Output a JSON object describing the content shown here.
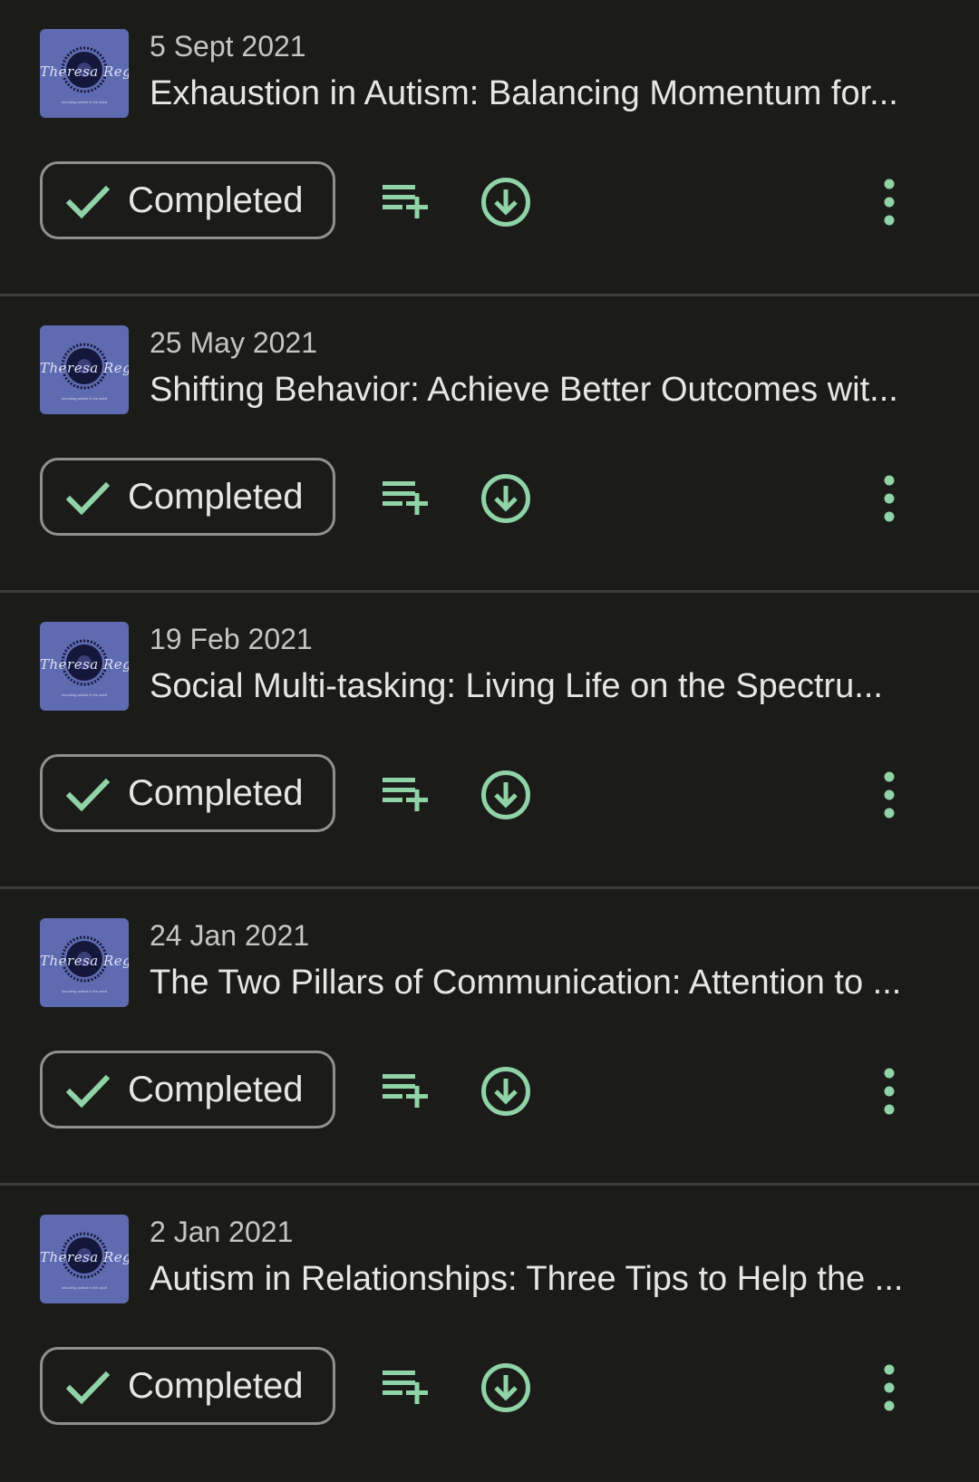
{
  "colors": {
    "background": "#1b1c1a",
    "accent": "#8fd3a6",
    "thumbnail": "#5f6bb0",
    "divider": "#3c3e3b"
  },
  "episodes": [
    {
      "date": "5 Sept 2021",
      "title": "Exhaustion in Autism: Balancing Momentum for...",
      "thumb_text": "Theresa Regan",
      "thumb_tagline": "decoding autism in the adult",
      "completed_label": "Completed",
      "icons": [
        "check-icon",
        "add-to-queue-icon",
        "download-icon",
        "more-vert-icon"
      ]
    },
    {
      "date": "25 May 2021",
      "title": "Shifting Behavior: Achieve Better Outcomes wit...",
      "thumb_text": "Theresa Regan",
      "thumb_tagline": "decoding autism in the adult",
      "completed_label": "Completed",
      "icons": [
        "check-icon",
        "add-to-queue-icon",
        "download-icon",
        "more-vert-icon"
      ]
    },
    {
      "date": "19 Feb 2021",
      "title": "Social Multi-tasking: Living Life on the Spectru...",
      "thumb_text": "Theresa Regan",
      "thumb_tagline": "decoding autism in the adult",
      "completed_label": "Completed",
      "icons": [
        "check-icon",
        "add-to-queue-icon",
        "download-icon",
        "more-vert-icon"
      ]
    },
    {
      "date": "24 Jan 2021",
      "title": "The Two Pillars of Communication: Attention to ...",
      "thumb_text": "Theresa Regan",
      "thumb_tagline": "decoding autism in the adult",
      "completed_label": "Completed",
      "icons": [
        "check-icon",
        "add-to-queue-icon",
        "download-icon",
        "more-vert-icon"
      ]
    },
    {
      "date": "2 Jan 2021",
      "title": "Autism in Relationships: Three Tips to Help the ...",
      "thumb_text": "Theresa Regan",
      "thumb_tagline": "decoding autism in the adult",
      "completed_label": "Completed",
      "icons": [
        "check-icon",
        "add-to-queue-icon",
        "download-icon",
        "more-vert-icon"
      ]
    }
  ]
}
